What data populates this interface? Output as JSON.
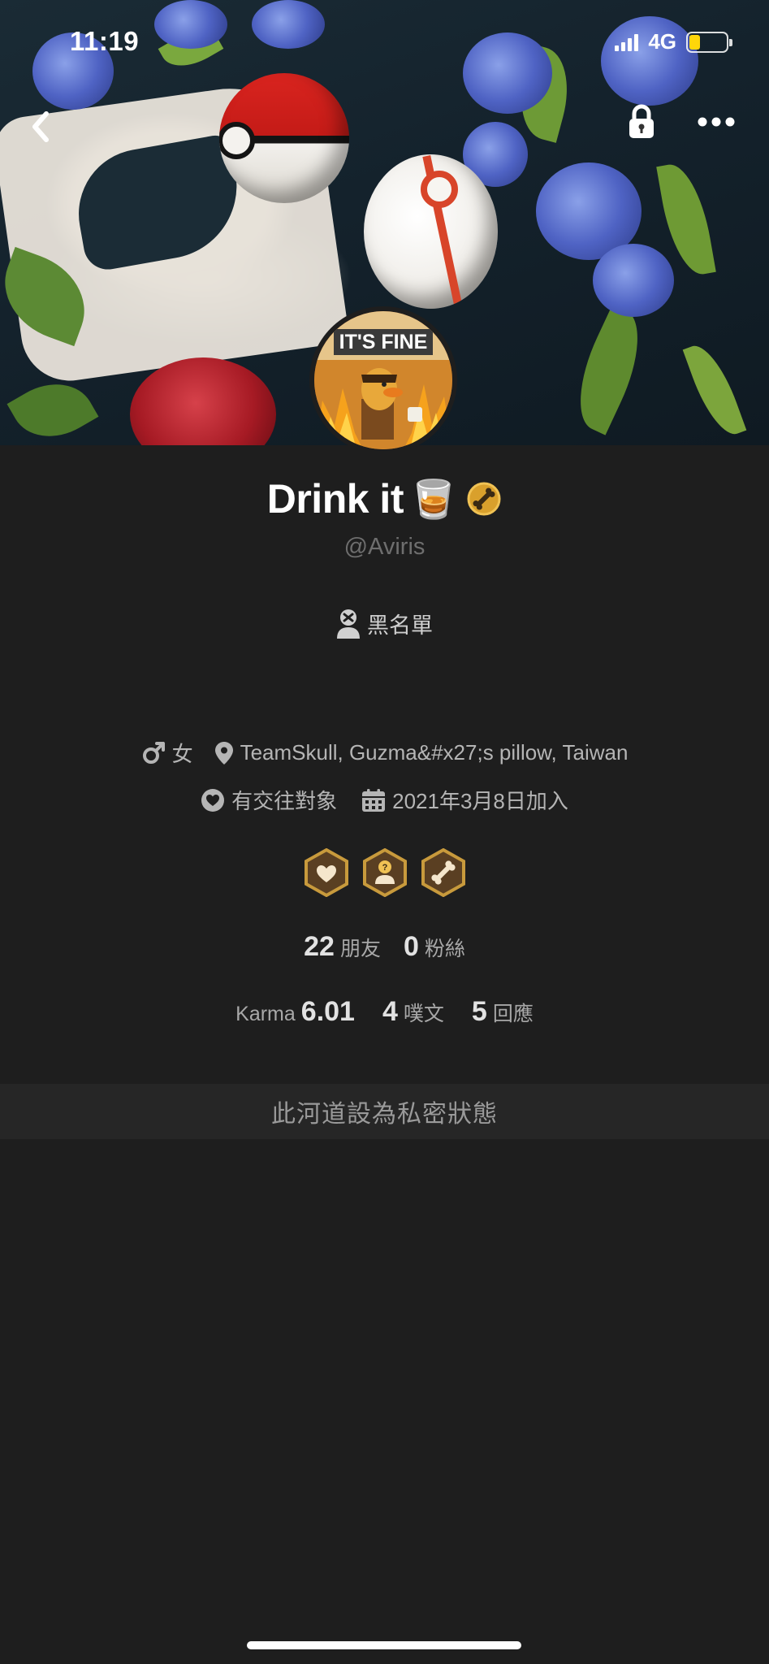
{
  "status_bar": {
    "time": "11:19",
    "network": "4G",
    "battery_level": 0.3,
    "battery_color": "#ffd60a"
  },
  "nav": {
    "back_icon": "chevron-left-icon",
    "lock_icon": "lock-icon",
    "more_icon": "ellipsis-icon"
  },
  "avatar": {
    "text": "IT'S FINE"
  },
  "profile": {
    "display_name": "Drink it",
    "name_emoji": "🥃",
    "username": "@Aviris"
  },
  "blacklist": {
    "label": "黑名單",
    "icon": "user-blocked-icon"
  },
  "details": {
    "gender": "女",
    "location": "TeamSkull, Guzma&#x27;s pillow, Taiwan",
    "relationship": "有交往對象",
    "joined": "2021年3月8日加入"
  },
  "badges": [
    "heart-badge",
    "mystery-user-badge",
    "bone-badge"
  ],
  "stats": {
    "friends_count": "22",
    "friends_label": "朋友",
    "fans_count": "0",
    "fans_label": "粉絲",
    "karma_label": "Karma",
    "karma_value": "6.01",
    "plurks_count": "4",
    "plurks_label": "噗文",
    "responses_count": "5",
    "responses_label": "回應"
  },
  "private_notice": "此河道設為私密狀態",
  "colors": {
    "background": "#1e1e1e",
    "badge_gold": "#c89a3c",
    "badge_fill": "#5a3f22"
  }
}
